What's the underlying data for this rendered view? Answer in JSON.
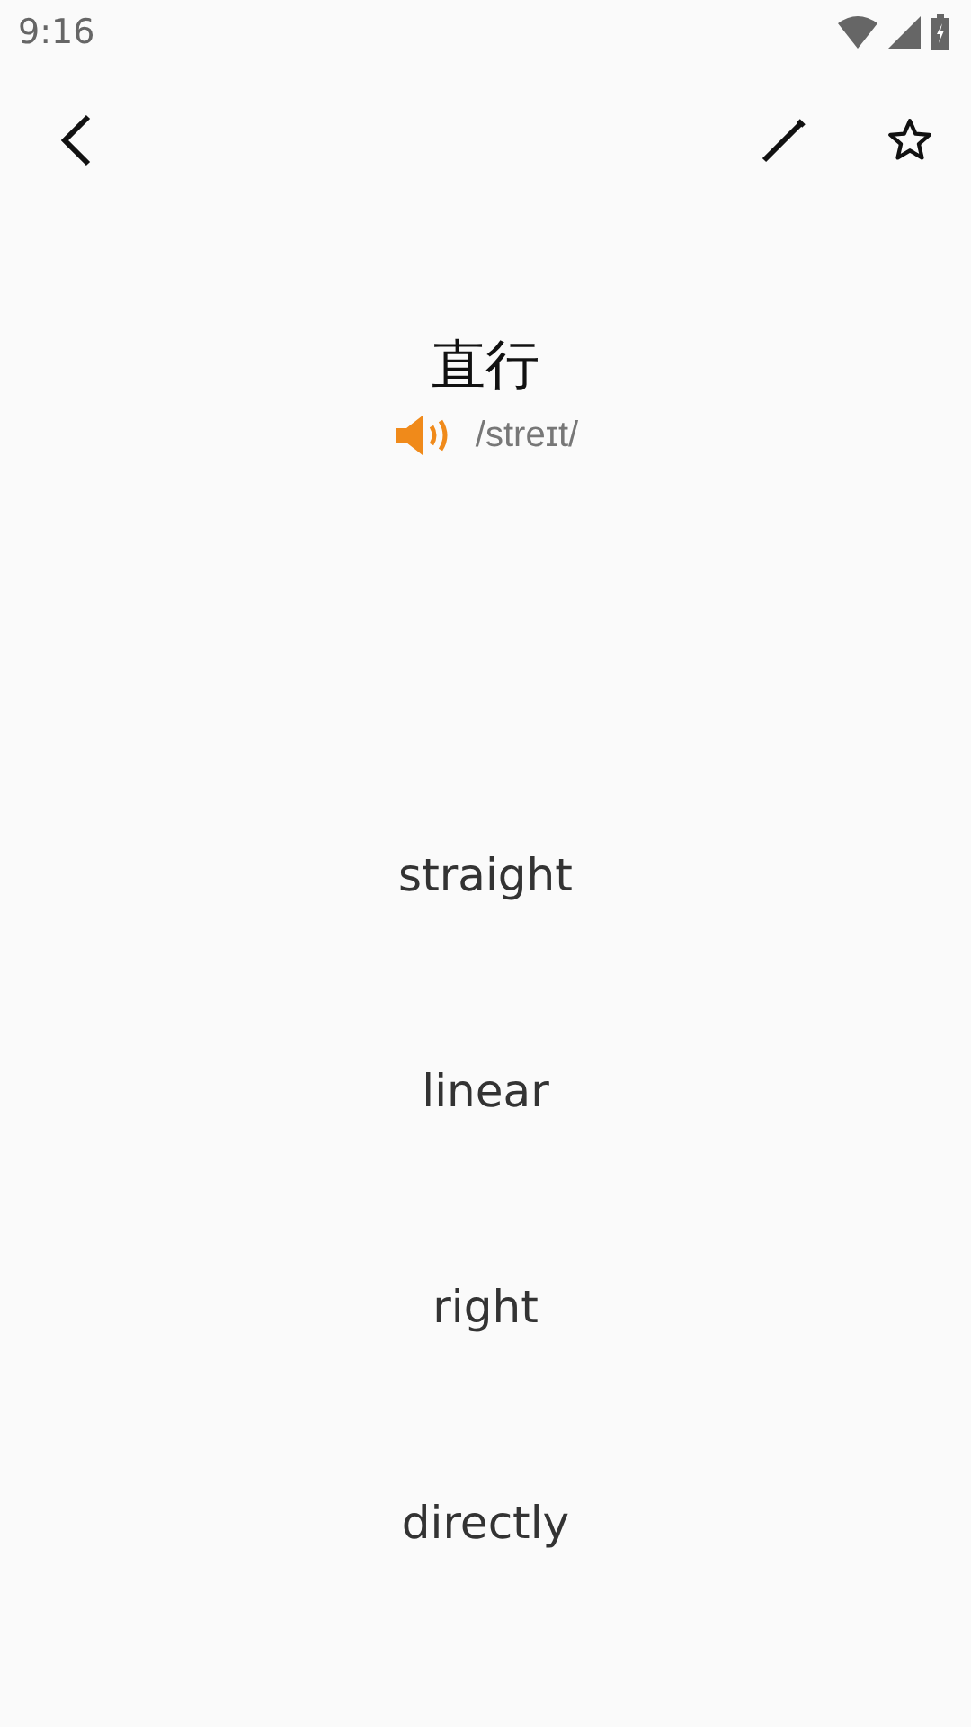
{
  "status_bar": {
    "time": "9:16"
  },
  "word": {
    "text": "直行",
    "phonetic": "/streɪt/"
  },
  "options": [
    {
      "label": "straight"
    },
    {
      "label": "linear"
    },
    {
      "label": "right"
    },
    {
      "label": "directly"
    }
  ]
}
